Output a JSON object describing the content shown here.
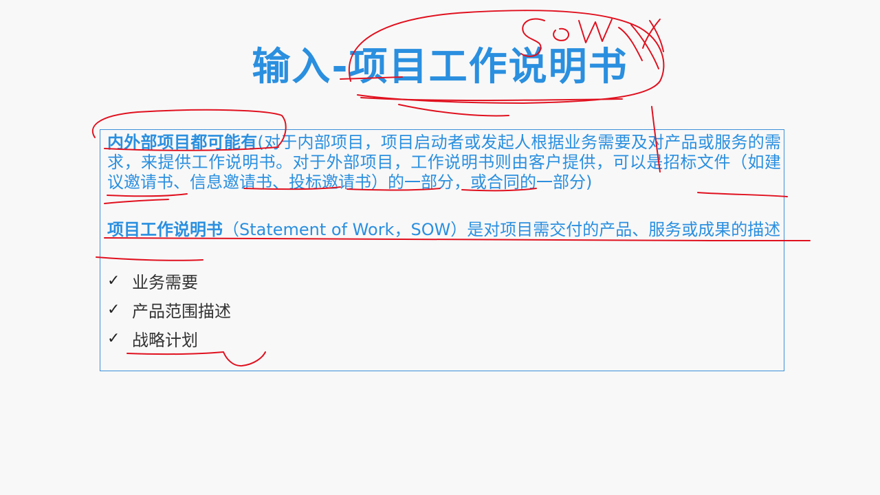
{
  "title": "输入-项目工作说明书",
  "paragraph1": {
    "bold": "内外部项目都可能有",
    "text": "(对于内部项目，项目启动者或发起人根据业务需要及对产品或服务的需求，来提供工作说明书。对于外部项目，工作说明书则由客户提供，可以是招标文件（如建议邀请书、信息邀请书、投标邀请书）的一部分，或合同的一部分)"
  },
  "paragraph2": {
    "bold": "项目工作说明书",
    "text": "（Statement of Work，SOW）是对项目需交付的产品、服务或成果的描述"
  },
  "checklist": [
    "业务需要",
    "产品范围描述",
    "战略计划"
  ],
  "check_symbol": "✓",
  "annotation_text": "SOW",
  "colors": {
    "accent": "#2a8fdf",
    "annotation": "#e0101e",
    "body_text": "#333333"
  }
}
